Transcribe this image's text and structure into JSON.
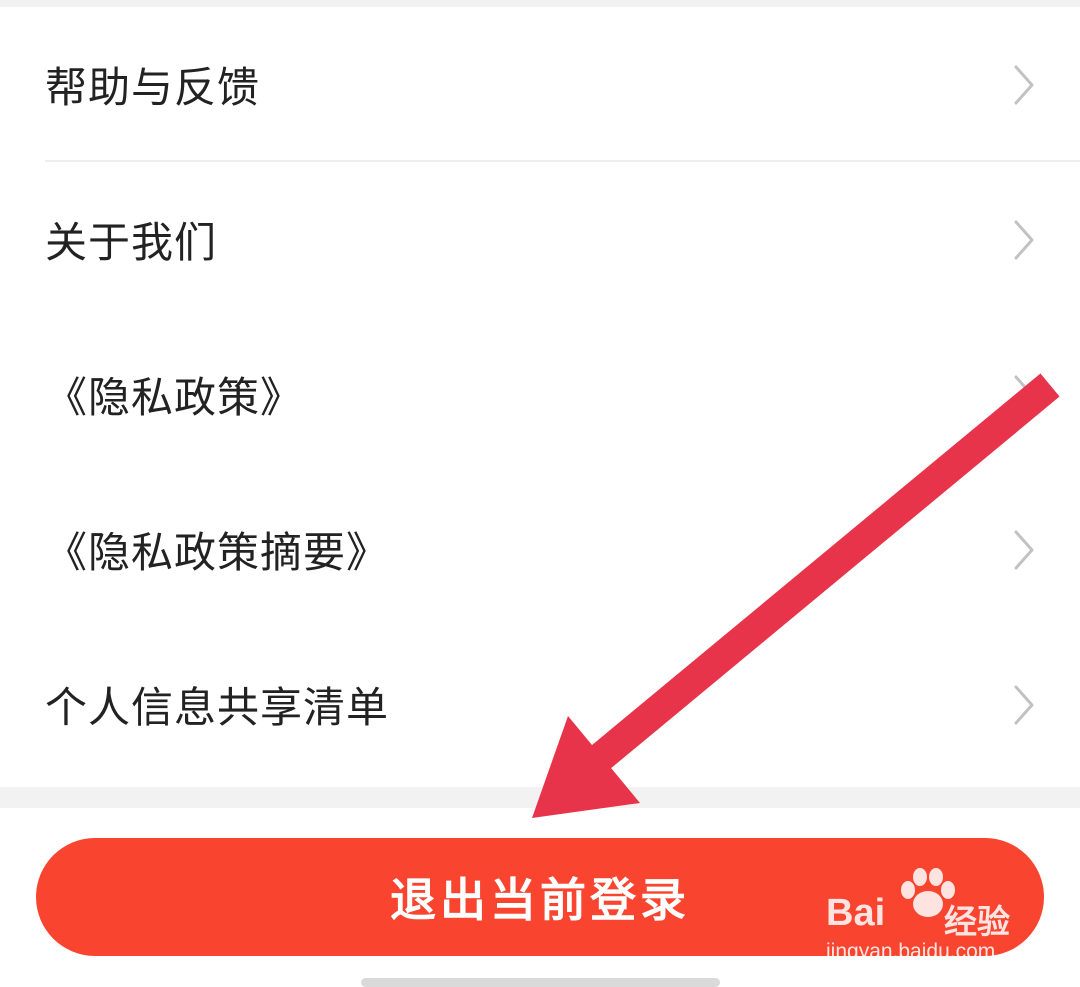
{
  "settings_menu": {
    "items": [
      {
        "label": "帮助与反馈",
        "icon": "chevron-right-icon"
      },
      {
        "label": "关于我们",
        "icon": "chevron-right-icon"
      },
      {
        "label": "《隐私政策》",
        "icon": "chevron-right-icon"
      },
      {
        "label": "《隐私政策摘要》",
        "icon": "chevron-right-icon"
      },
      {
        "label": "个人信息共享清单",
        "icon": "chevron-right-icon"
      }
    ]
  },
  "logout_button": {
    "label": "退出当前登录",
    "color": "#f9452f"
  },
  "annotation": {
    "arrow_color": "#e8344a"
  },
  "watermark": {
    "brand": "Bai",
    "suffix": "经验",
    "url": "jingyan.baidu.com"
  }
}
